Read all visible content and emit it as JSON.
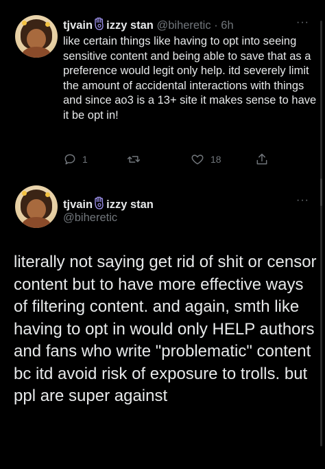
{
  "tweet1": {
    "display_name_prefix": "tjvain",
    "display_name_suffix": "izzy stan",
    "handle": "@biheretic",
    "time": "· 6h",
    "more_label": "···",
    "text": "like certain things like having to opt into seeing sensitive content and being able to save that as a preference would legit only help. itd severely limit the amount of accidental interactions with things and since ao3 is a 13+ site it makes sense to have it be opt in!",
    "reply_count": "1",
    "retweet_count": "",
    "like_count": "18"
  },
  "tweet2": {
    "display_name_prefix": "tjvain",
    "display_name_suffix": "izzy stan",
    "handle": "@biheretic",
    "more_label": "···",
    "text": "literally not saying get rid of shit or censor content but to have more effective ways of filtering content. and again, smth like having to opt in would only HELP authors and fans who write \"problematic\" content bc itd avoid risk of exposure to trolls. but ppl are super against"
  },
  "icons": {
    "reply": "reply-icon",
    "retweet": "retweet-icon",
    "like": "heart-icon",
    "share": "share-icon",
    "hamsa": "hamsa-icon"
  },
  "colors": {
    "background": "#000000",
    "text": "#e7e9ea",
    "secondary": "#71767b",
    "hamsa": "#9b8fe8"
  }
}
